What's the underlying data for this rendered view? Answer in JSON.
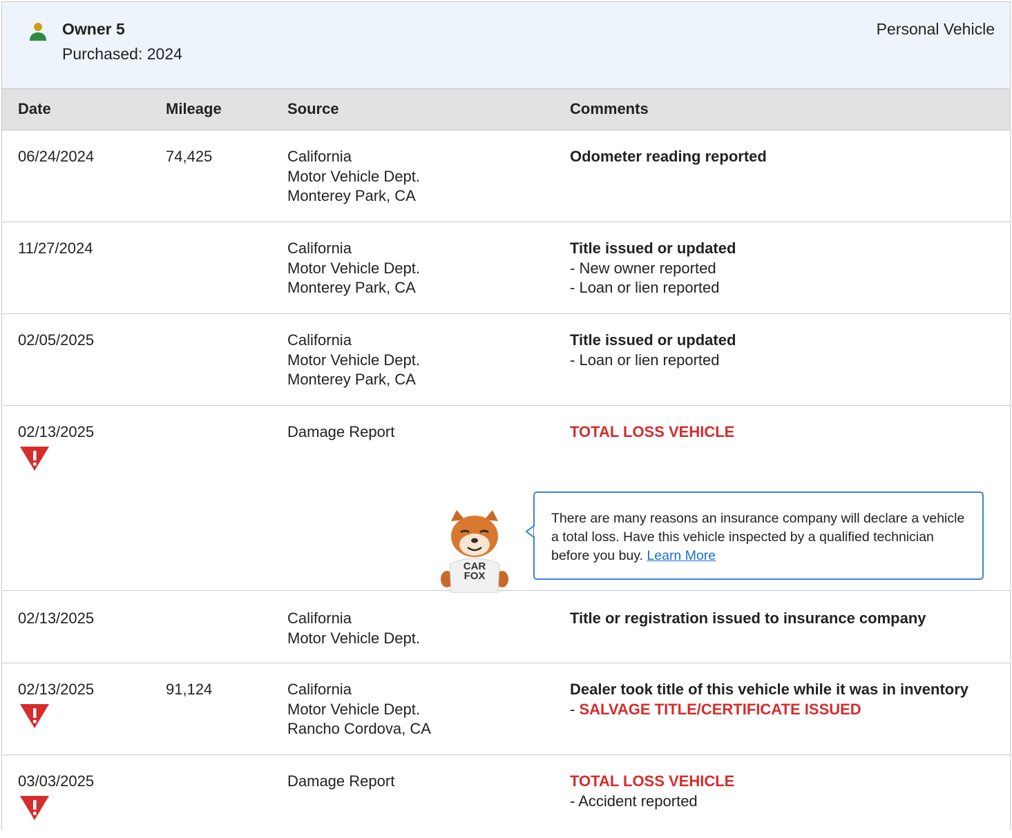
{
  "owner": {
    "name": "Owner 5",
    "purchased": "Purchased: 2024",
    "vehicle_type": "Personal Vehicle",
    "icon": "person-icon",
    "icon_colors": {
      "head": "#d19b1a",
      "body": "#2e8b3e"
    }
  },
  "table": {
    "headers": {
      "date": "Date",
      "mileage": "Mileage",
      "source": "Source",
      "comments": "Comments"
    },
    "rows": [
      {
        "date": "06/24/2024",
        "mileage": "74,425",
        "source": [
          "California",
          "Motor Vehicle Dept.",
          "Monterey Park, CA"
        ],
        "comment_title": "Odometer reading reported",
        "comment_details": []
      },
      {
        "date": "11/27/2024",
        "mileage": "",
        "source": [
          "California",
          "Motor Vehicle Dept.",
          "Monterey Park, CA"
        ],
        "comment_title": "Title issued or updated",
        "comment_details": [
          "New owner reported",
          "Loan or lien reported"
        ]
      },
      {
        "date": "02/05/2025",
        "mileage": "",
        "source": [
          "California",
          "Motor Vehicle Dept.",
          "Monterey Park, CA"
        ],
        "comment_title": "Title issued or updated",
        "comment_details": [
          "Loan or lien reported"
        ]
      },
      {
        "date": "02/13/2025",
        "mileage": "",
        "alert": "warning-triangle-icon",
        "source": [
          "Damage Report"
        ],
        "comment_title": "TOTAL LOSS VEHICLE",
        "comment_details": []
      },
      {
        "date": "02/13/2025",
        "mileage": "",
        "source": [
          "California",
          "Motor Vehicle Dept."
        ],
        "comment_title": "Title or registration issued to insurance company",
        "comment_details": []
      },
      {
        "date": "02/13/2025",
        "mileage": "91,124",
        "alert": "warning-triangle-icon",
        "source": [
          "California",
          "Motor Vehicle Dept.",
          "Rancho Cordova, CA"
        ],
        "comment_title": "Dealer took title of this vehicle while it was in inventory",
        "comment_details": [
          "SALVAGE TITLE/CERTIFICATE ISSUED"
        ]
      },
      {
        "date": "03/03/2025",
        "mileage": "",
        "alert": "warning-triangle-icon",
        "source": [
          "Damage Report"
        ],
        "comment_title": "TOTAL LOSS VEHICLE",
        "comment_details": [
          "Accident reported"
        ]
      }
    ]
  },
  "tooltip": {
    "text": "There are many reasons an insurance company will declare a vehicle a total loss. Have this vehicle inspected by a qualified technician before you buy.",
    "link": "Learn More",
    "mascot_shirt": [
      "CAR",
      "FOX"
    ],
    "border_color": "#3b82d6"
  },
  "colors": {
    "alert_red": "#d62c2c",
    "header_bg": "#eef4fb",
    "table_head_bg": "#e2e2e2",
    "link": "#1a6fd6"
  }
}
